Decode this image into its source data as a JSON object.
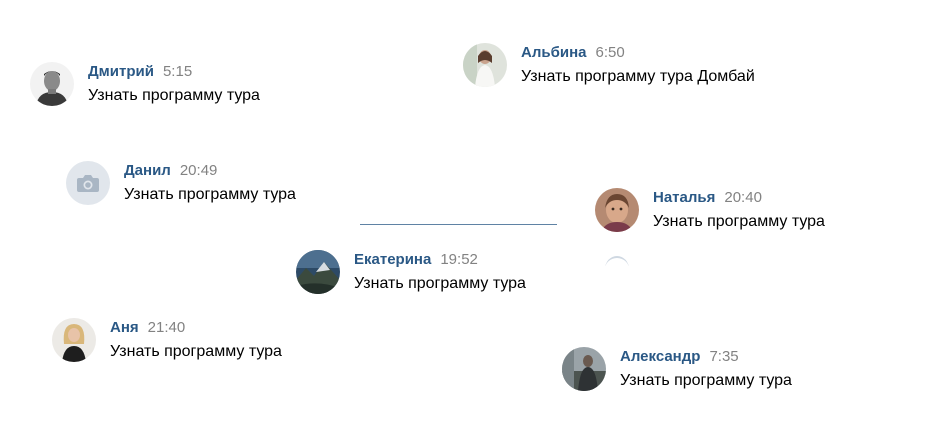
{
  "messages": [
    {
      "name": "Дмитрий",
      "time": "5:15",
      "text": "Узнать программу тура",
      "avatar": "photo-man-grayscale"
    },
    {
      "name": "Альбина",
      "time": "6:50",
      "text": "Узнать программу тура Домбай",
      "avatar": "photo-woman-white"
    },
    {
      "name": "Данил",
      "time": "20:49",
      "text": "Узнать программу тура",
      "avatar": "camera-placeholder-icon"
    },
    {
      "name": "Наталья",
      "time": "20:40",
      "text": "Узнать программу тура",
      "avatar": "photo-woman-portrait"
    },
    {
      "name": "Екатерина",
      "time": "19:52",
      "text": "Узнать программу тура",
      "avatar": "photo-mountains"
    },
    {
      "name": "Аня",
      "time": "21:40",
      "text": "Узнать программу тура",
      "avatar": "photo-woman-blonde"
    },
    {
      "name": "Александр",
      "time": "7:35",
      "text": "Узнать программу тура",
      "avatar": "photo-man-outdoor"
    }
  ],
  "colors": {
    "name": "#2a5885",
    "time": "#828282",
    "text": "#000000",
    "placeholder_bg": "#e1e6ec",
    "placeholder_icon": "#a9b6c4"
  }
}
